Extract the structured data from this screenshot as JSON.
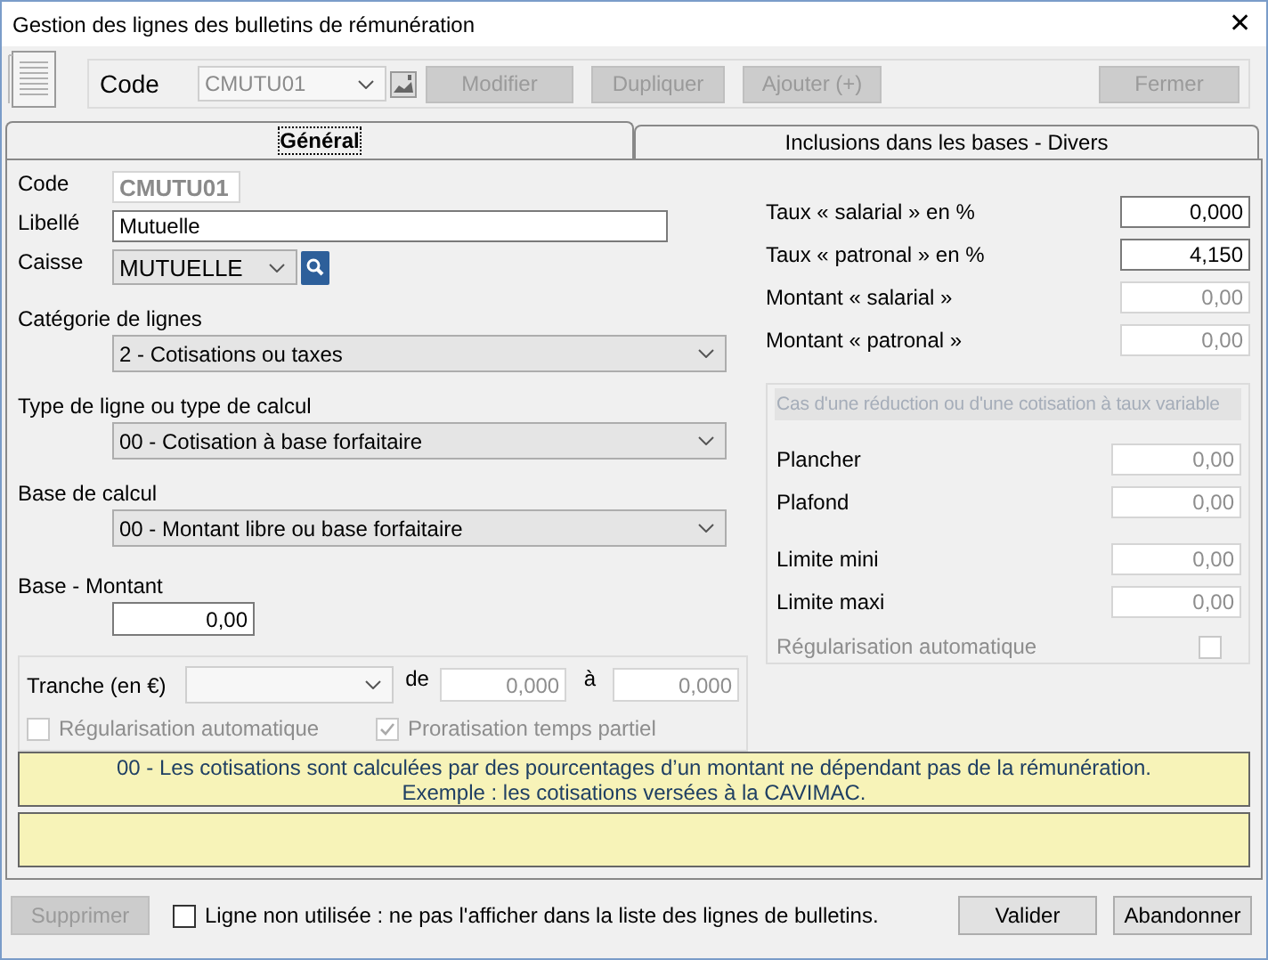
{
  "window": {
    "title": "Gestion des lignes des bulletins de rémunération",
    "close": "✕"
  },
  "toolbar": {
    "code_label": "Code",
    "code_value": "CMUTU01",
    "buttons": [
      {
        "label": "Modifier",
        "disabled": true
      },
      {
        "label": "Dupliquer",
        "disabled": true
      },
      {
        "label": "Ajouter (+)",
        "disabled": true
      },
      {
        "label": "Fermer",
        "disabled": true
      }
    ]
  },
  "tabs": [
    {
      "label": "Général",
      "selected": true
    },
    {
      "label": "Inclusions dans les bases - Divers",
      "selected": false
    }
  ],
  "general": {
    "code": {
      "label": "Code",
      "value": "CMUTU01"
    },
    "libelle": {
      "label": "Libellé",
      "value": "Mutuelle"
    },
    "caisse": {
      "label": "Caisse",
      "value": "MUTUELLE"
    },
    "selects": [
      {
        "label": "Catégorie de lignes",
        "value": "2 - Cotisations ou taxes"
      },
      {
        "label": "Type de ligne ou type de calcul",
        "value": "00 - Cotisation à base forfaitaire"
      },
      {
        "label": "Base de calcul",
        "value": "00 - Montant libre ou base forfaitaire"
      }
    ],
    "base_montant": {
      "label": "Base - Montant",
      "value": "0,00"
    },
    "tranche": {
      "label": "Tranche (en €)",
      "disabled": true,
      "from_label": "de",
      "from_value": "0,000",
      "to_label": "à",
      "to_value": "0,000",
      "checkboxes": [
        {
          "label": "Régularisation automatique",
          "checked": false,
          "disabled": true
        },
        {
          "label": "Proratisation temps partiel",
          "checked": true,
          "disabled": true
        }
      ]
    },
    "rates": [
      {
        "label": "Taux « salarial » en %",
        "value": "0,000",
        "disabled": false
      },
      {
        "label": "Taux « patronal » en %",
        "value": "4,150",
        "disabled": false
      },
      {
        "label": "Montant « salarial »",
        "value": "0,00",
        "disabled": true
      },
      {
        "label": "Montant « patronal »",
        "value": "0,00",
        "disabled": true
      }
    ],
    "reduction": {
      "title": "Cas d'une réduction ou d'une cotisation à taux variable",
      "rows": [
        {
          "label": "Plancher",
          "value": "0,00",
          "disabled": true
        },
        {
          "label": "Plafond",
          "value": "0,00",
          "disabled": true
        },
        {
          "label": "Limite mini",
          "value": "0,00",
          "disabled": true
        },
        {
          "label": "Limite maxi",
          "value": "0,00",
          "disabled": true
        }
      ],
      "checkbox": {
        "label": "Régularisation automatique",
        "checked": false,
        "disabled": true
      }
    },
    "info": [
      "00 - Les cotisations sont calculées par des pourcentages d’un montant ne dépendant pas de la rémunération.",
      "Exemple : les cotisations versées à la CAVIMAC."
    ]
  },
  "footer": {
    "delete": {
      "label": "Supprimer",
      "disabled": true
    },
    "unused": {
      "label": "Ligne non utilisée : ne pas l'afficher dans la liste des lignes de bulletins.",
      "checked": false
    },
    "buttons": [
      {
        "label": "Valider",
        "disabled": false
      },
      {
        "label": "Abandonner",
        "disabled": false
      }
    ]
  }
}
